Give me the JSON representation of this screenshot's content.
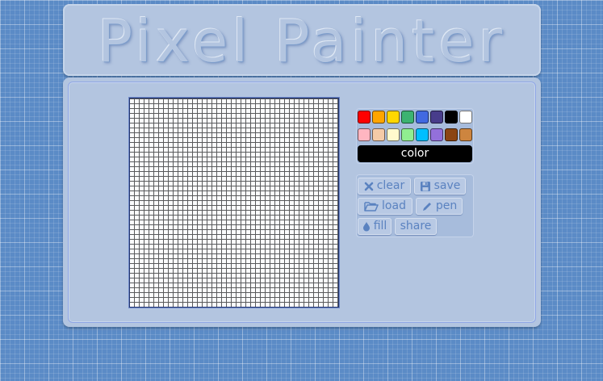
{
  "app": {
    "title": "Pixel Painter"
  },
  "canvas": {
    "rows": 43,
    "cols": 43
  },
  "palette": {
    "swatches": [
      {
        "color": "#ff0000"
      },
      {
        "color": "#ffa500"
      },
      {
        "color": "#ffd700"
      },
      {
        "color": "#3cb371"
      },
      {
        "color": "#4169e1"
      },
      {
        "color": "#483d8b"
      },
      {
        "color": "#000000"
      },
      {
        "color": "#ffffff"
      },
      {
        "color": "#ffb6c1"
      },
      {
        "color": "#f5cba7"
      },
      {
        "color": "#fffacd"
      },
      {
        "color": "#90ee90"
      },
      {
        "color": "#00bfff"
      },
      {
        "color": "#9370db"
      },
      {
        "color": "#8b4513"
      },
      {
        "color": "#cd853f"
      }
    ],
    "selected_color": "#000000",
    "color_label": "color"
  },
  "toolbar": {
    "clear_label": "clear",
    "save_label": "save",
    "load_label": "load",
    "pen_label": "pen",
    "fill_label": "fill",
    "share_label": "share"
  }
}
